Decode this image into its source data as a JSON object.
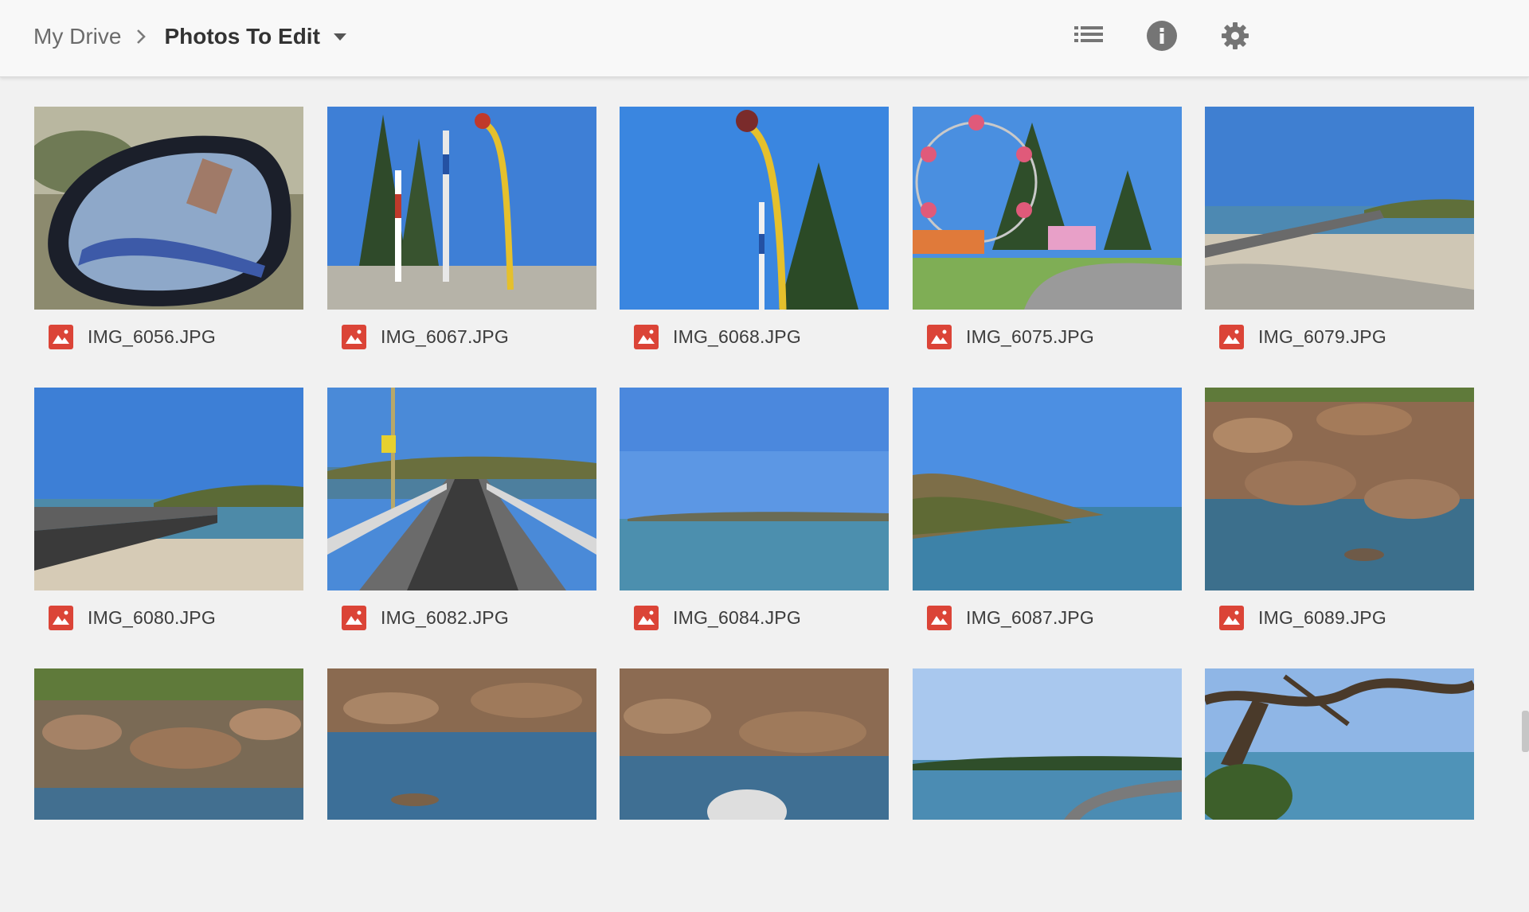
{
  "breadcrumb": {
    "root": "My Drive",
    "current": "Photos To Edit"
  },
  "header": {
    "icons": [
      "list-view-icon",
      "info-icon",
      "settings-gear-icon"
    ]
  },
  "colors": {
    "file_icon_red": "#db4437",
    "header_bg": "#f8f8f8",
    "grid_bg": "#f1f1f1"
  },
  "files": [
    {
      "name": "IMG_6056.JPG"
    },
    {
      "name": "IMG_6067.JPG"
    },
    {
      "name": "IMG_6068.JPG"
    },
    {
      "name": "IMG_6075.JPG"
    },
    {
      "name": "IMG_6079.JPG"
    },
    {
      "name": "IMG_6080.JPG"
    },
    {
      "name": "IMG_6082.JPG"
    },
    {
      "name": "IMG_6084.JPG"
    },
    {
      "name": "IMG_6087.JPG"
    },
    {
      "name": "IMG_6089.JPG"
    },
    {
      "name": ""
    },
    {
      "name": ""
    },
    {
      "name": ""
    },
    {
      "name": ""
    },
    {
      "name": ""
    }
  ]
}
